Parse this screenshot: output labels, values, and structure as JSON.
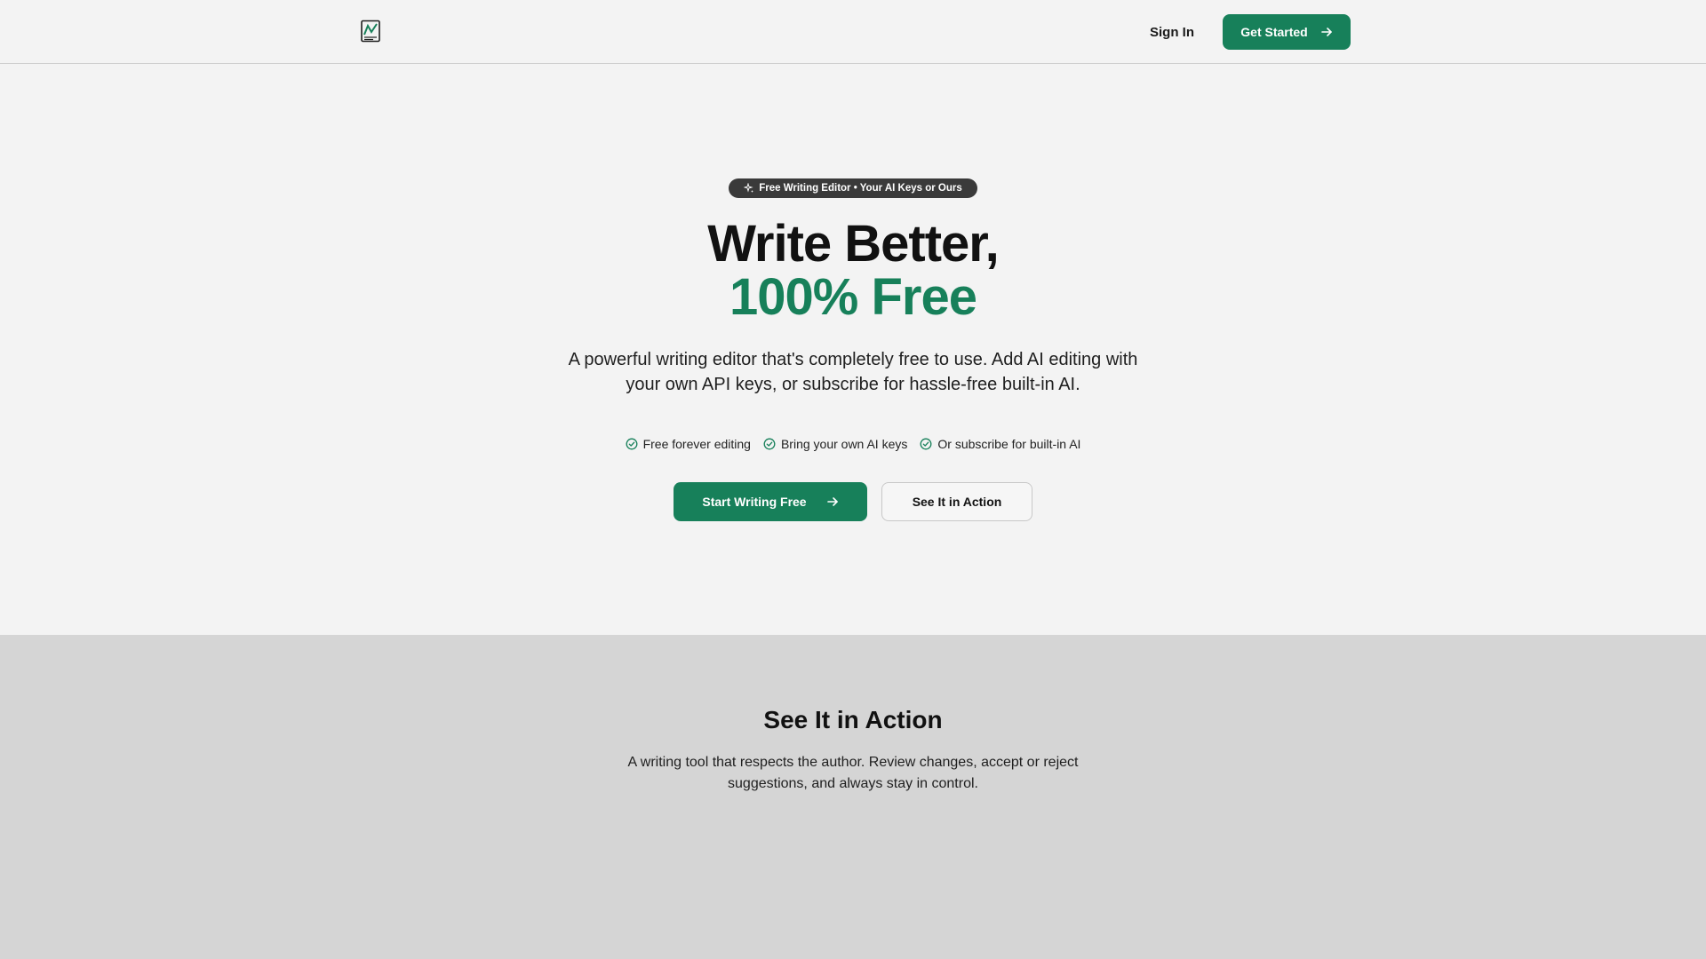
{
  "header": {
    "logo_icon": "document-chart-logo-icon",
    "signin_label": "Sign In",
    "get_started_label": "Get Started"
  },
  "hero": {
    "badge": "Free Writing Editor • Your AI Keys or Ours",
    "title_line1": "Write Better,",
    "title_line2": "100% Free",
    "subtitle": "A powerful writing editor that's completely free to use. Add AI editing with your own API keys, or subscribe for hassle-free built-in AI.",
    "features": [
      "Free forever editing",
      "Bring your own AI keys",
      "Or subscribe for built-in AI"
    ],
    "cta_primary": "Start Writing Free",
    "cta_secondary": "See It in Action"
  },
  "section": {
    "title": "See It in Action",
    "subtitle": "A writing tool that respects the author. Review changes, accept or reject suggestions, and always stay in control."
  },
  "colors": {
    "accent": "#17805a",
    "background": "#f3f3f3",
    "section_background": "#d5d5d5",
    "badge_background": "#3a3a3a"
  }
}
